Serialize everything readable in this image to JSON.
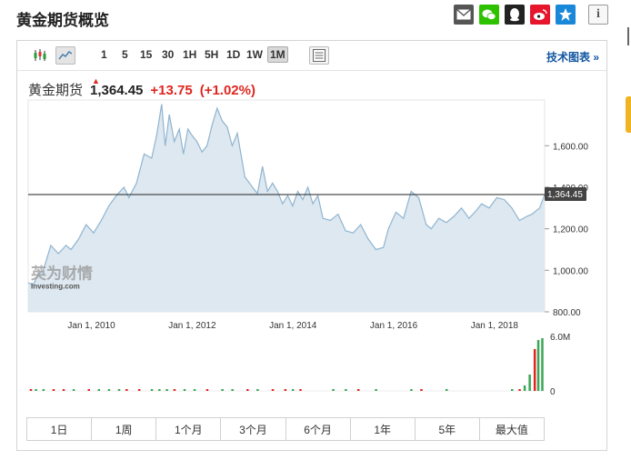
{
  "page": {
    "title": "黄金期货概览"
  },
  "share_icons": [
    "email-icon",
    "wechat-icon",
    "qq-icon",
    "weibo-icon",
    "favorite-star-icon"
  ],
  "info_label": "i",
  "toolbar": {
    "ranges": [
      "1",
      "5",
      "15",
      "30",
      "1H",
      "5H",
      "1D",
      "1W",
      "1M"
    ],
    "active_range": "1M",
    "tech_chart_label": "技术图表 »"
  },
  "quote": {
    "name": "黄金期货",
    "price": "1,364.45",
    "change": "+13.75",
    "change_pct": "(+1.02%)"
  },
  "watermark": {
    "brand_cn": "英为财情",
    "brand_en": "Investing.com"
  },
  "periods": [
    "1日",
    "1周",
    "1个月",
    "3个月",
    "6个月",
    "1年",
    "5年",
    "最大值"
  ],
  "colors": {
    "up": "#e0261f",
    "down": "#3aa757",
    "area_fill": "#dde8f0",
    "line": "#8fb4d0",
    "link": "#1256a0"
  },
  "chart_data": {
    "type": "area",
    "x_tick_labels": [
      "Jan 1, 2010",
      "Jan 1, 2012",
      "Jan 1, 2014",
      "Jan 1, 2016",
      "Jan 1, 2018"
    ],
    "y_tick_labels": [
      "1,600.00",
      "1,400.00",
      "1,200.00",
      "1,000.00",
      "800.00"
    ],
    "y_ticks": [
      1600,
      1400,
      1200,
      1000,
      800
    ],
    "ylim": [
      800,
      1820
    ],
    "x_range": [
      2009.0,
      2019.25
    ],
    "last_price": 1364.45,
    "last_price_label": "1,364.45",
    "series": [
      {
        "x": [
          2009.0,
          2009.1,
          2009.2,
          2009.3,
          2009.45,
          2009.6,
          2009.75,
          2009.85,
          2010.0,
          2010.15,
          2010.3,
          2010.45,
          2010.6,
          2010.75,
          2010.9,
          2011.0,
          2011.15,
          2011.3,
          2011.45,
          2011.55,
          2011.65,
          2011.72,
          2011.8,
          2011.9,
          2012.0,
          2012.08,
          2012.17,
          2012.25,
          2012.35,
          2012.45,
          2012.55,
          2012.65,
          2012.75,
          2012.85,
          2012.95,
          2013.05,
          2013.15,
          2013.3,
          2013.45,
          2013.55,
          2013.65,
          2013.75,
          2013.85,
          2013.95,
          2014.05,
          2014.15,
          2014.25,
          2014.35,
          2014.45,
          2014.55,
          2014.65,
          2014.75,
          2014.85,
          2015.0,
          2015.15,
          2015.3,
          2015.45,
          2015.6,
          2015.75,
          2015.9,
          2016.05,
          2016.15,
          2016.3,
          2016.45,
          2016.6,
          2016.75,
          2016.9,
          2017.0,
          2017.15,
          2017.3,
          2017.45,
          2017.6,
          2017.75,
          2017.9,
          2018.0,
          2018.15,
          2018.3,
          2018.45,
          2018.6,
          2018.75,
          2018.9,
          2019.0,
          2019.15,
          2019.25
        ],
        "y": [
          940,
          930,
          980,
          1000,
          1120,
          1080,
          1120,
          1100,
          1150,
          1220,
          1180,
          1240,
          1310,
          1360,
          1400,
          1350,
          1420,
          1560,
          1540,
          1650,
          1800,
          1600,
          1750,
          1620,
          1680,
          1560,
          1680,
          1650,
          1620,
          1570,
          1600,
          1700,
          1780,
          1720,
          1690,
          1600,
          1660,
          1450,
          1400,
          1370,
          1500,
          1380,
          1420,
          1380,
          1320,
          1360,
          1310,
          1380,
          1340,
          1400,
          1320,
          1360,
          1250,
          1240,
          1270,
          1190,
          1180,
          1220,
          1150,
          1100,
          1110,
          1200,
          1280,
          1250,
          1380,
          1350,
          1220,
          1200,
          1250,
          1230,
          1260,
          1300,
          1250,
          1290,
          1320,
          1300,
          1350,
          1340,
          1300,
          1240,
          1260,
          1270,
          1300,
          1364
        ]
      }
    ],
    "volume": {
      "label_top": "6.0M",
      "label_zero": "0",
      "max": 6000000,
      "bars": [
        {
          "x": 2009.05,
          "v": 80000,
          "dir": "down"
        },
        {
          "x": 2009.15,
          "v": 80000,
          "dir": "up"
        },
        {
          "x": 2009.3,
          "v": 60000,
          "dir": "up"
        },
        {
          "x": 2009.5,
          "v": 60000,
          "dir": "down"
        },
        {
          "x": 2009.7,
          "v": 60000,
          "dir": "down"
        },
        {
          "x": 2009.9,
          "v": 60000,
          "dir": "up"
        },
        {
          "x": 2010.2,
          "v": 60000,
          "dir": "down"
        },
        {
          "x": 2010.4,
          "v": 60000,
          "dir": "up"
        },
        {
          "x": 2010.6,
          "v": 60000,
          "dir": "up"
        },
        {
          "x": 2010.8,
          "v": 60000,
          "dir": "up"
        },
        {
          "x": 2010.95,
          "v": 60000,
          "dir": "down"
        },
        {
          "x": 2011.2,
          "v": 60000,
          "dir": "down"
        },
        {
          "x": 2011.45,
          "v": 60000,
          "dir": "up"
        },
        {
          "x": 2011.6,
          "v": 60000,
          "dir": "up"
        },
        {
          "x": 2011.75,
          "v": 60000,
          "dir": "up"
        },
        {
          "x": 2011.9,
          "v": 60000,
          "dir": "down"
        },
        {
          "x": 2012.1,
          "v": 60000,
          "dir": "up"
        },
        {
          "x": 2012.3,
          "v": 60000,
          "dir": "up"
        },
        {
          "x": 2012.55,
          "v": 60000,
          "dir": "down"
        },
        {
          "x": 2012.85,
          "v": 60000,
          "dir": "up"
        },
        {
          "x": 2013.05,
          "v": 60000,
          "dir": "up"
        },
        {
          "x": 2013.35,
          "v": 60000,
          "dir": "down"
        },
        {
          "x": 2013.55,
          "v": 60000,
          "dir": "up"
        },
        {
          "x": 2013.85,
          "v": 60000,
          "dir": "down"
        },
        {
          "x": 2014.1,
          "v": 60000,
          "dir": "down"
        },
        {
          "x": 2014.25,
          "v": 60000,
          "dir": "up"
        },
        {
          "x": 2014.4,
          "v": 60000,
          "dir": "down"
        },
        {
          "x": 2015.05,
          "v": 60000,
          "dir": "up"
        },
        {
          "x": 2015.3,
          "v": 60000,
          "dir": "up"
        },
        {
          "x": 2015.55,
          "v": 60000,
          "dir": "down"
        },
        {
          "x": 2015.9,
          "v": 60000,
          "dir": "up"
        },
        {
          "x": 2016.6,
          "v": 60000,
          "dir": "up"
        },
        {
          "x": 2016.8,
          "v": 60000,
          "dir": "down"
        },
        {
          "x": 2017.3,
          "v": 60000,
          "dir": "up"
        },
        {
          "x": 2018.6,
          "v": 80000,
          "dir": "up"
        },
        {
          "x": 2018.75,
          "v": 100000,
          "dir": "down"
        },
        {
          "x": 2018.85,
          "v": 600000,
          "dir": "up"
        },
        {
          "x": 2018.95,
          "v": 1800000,
          "dir": "up"
        },
        {
          "x": 2019.05,
          "v": 4600000,
          "dir": "down"
        },
        {
          "x": 2019.12,
          "v": 5600000,
          "dir": "up"
        },
        {
          "x": 2019.2,
          "v": 5800000,
          "dir": "up"
        }
      ]
    }
  }
}
